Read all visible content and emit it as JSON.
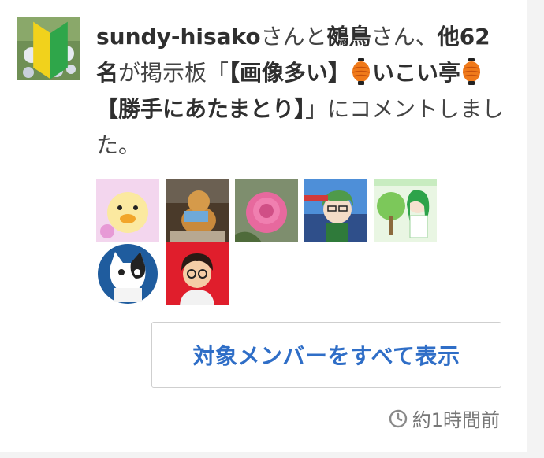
{
  "activity": {
    "actor1": "sundy-hisako",
    "join1": "さんと",
    "actor2": "鵺鳥",
    "join2": "さん、",
    "others": "他62名",
    "join3": "が掲示板「",
    "board_part1": "【画像多い】",
    "board_part2": "いこい亭",
    "board_part3": "【勝手にあたまとり】",
    "tail": "」にコメントしました。"
  },
  "members": {
    "avatar_icons": [
      "chick-avatar",
      "dog-avatar",
      "rose-avatar",
      "anime-green-hair-avatar",
      "green-tree-girl-avatar",
      "cat-avatar",
      "man-avatar"
    ],
    "show_all_label": "対象メンバーをすべて表示"
  },
  "meta": {
    "time_label": "約1時間前",
    "clock_icon": "clock-icon"
  },
  "colors": {
    "accent": "#2f6ec7",
    "text": "#444444",
    "muted": "#777777"
  }
}
